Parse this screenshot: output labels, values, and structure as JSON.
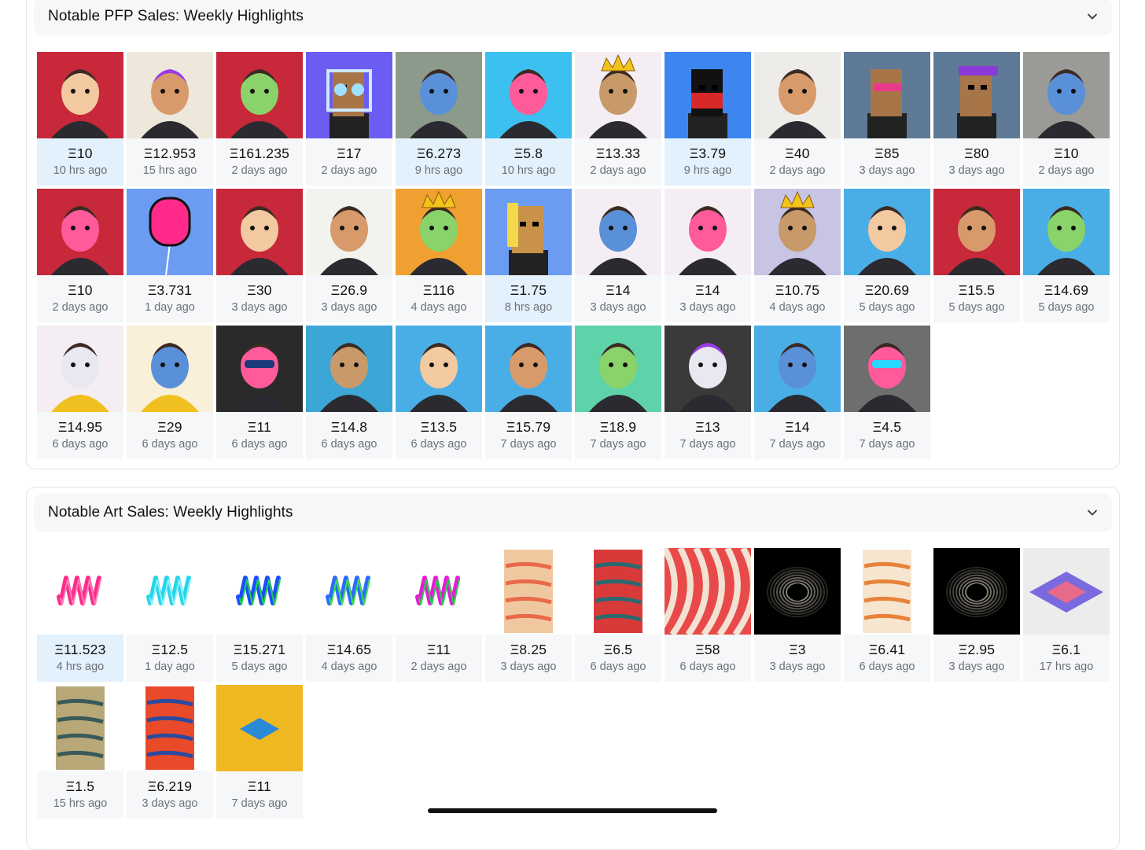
{
  "pfp_section": {
    "title": "Notable PFP Sales: Weekly Highlights",
    "toggle_icon": "chevron-down-icon",
    "items": [
      {
        "price": "Ξ10",
        "time": "10 hrs ago",
        "highlight": true,
        "bg": "#c7283a",
        "avatar": "round-armored-character"
      },
      {
        "price": "Ξ12.953",
        "time": "15 hrs ago",
        "highlight": false,
        "bg": "#ede7dc",
        "avatar": "flaming-skull-priest"
      },
      {
        "price": "Ξ161.235",
        "time": "2 days ago",
        "highlight": false,
        "bg": "#c7283a",
        "avatar": "sketch-woman-profile"
      },
      {
        "price": "Ξ17",
        "time": "2 days ago",
        "highlight": false,
        "bg": "#6b5cf2",
        "avatar": "pixel-owl"
      },
      {
        "price": "Ξ6.273",
        "time": "9 hrs ago",
        "highlight": true,
        "bg": "#8b9a8a",
        "avatar": "green-creature-headphones"
      },
      {
        "price": "Ξ5.8",
        "time": "10 hrs ago",
        "highlight": true,
        "bg": "#3cc0f0",
        "avatar": "hooded-ghost"
      },
      {
        "price": "Ξ13.33",
        "time": "2 days ago",
        "highlight": false,
        "bg": "#f4eef4",
        "avatar": "clown-king"
      },
      {
        "price": "Ξ3.79",
        "time": "9 hrs ago",
        "highlight": true,
        "bg": "#3d86f0",
        "avatar": "pixel-ninja"
      },
      {
        "price": "Ξ40",
        "time": "2 days ago",
        "highlight": false,
        "bg": "#eeece8",
        "avatar": "anime-pilot"
      },
      {
        "price": "Ξ85",
        "time": "3 days ago",
        "highlight": false,
        "bg": "#5e7a96",
        "avatar": "pixel-punk-glasses"
      },
      {
        "price": "Ξ80",
        "time": "3 days ago",
        "highlight": false,
        "bg": "#5e7a96",
        "avatar": "pixel-punk-cap"
      },
      {
        "price": "Ξ10",
        "time": "2 days ago",
        "highlight": false,
        "bg": "#9a9a96",
        "avatar": "blue-warrior-axe"
      },
      {
        "price": "Ξ10",
        "time": "2 days ago",
        "highlight": false,
        "bg": "#c7283a",
        "avatar": "dark-ninja-character"
      },
      {
        "price": "Ξ3.731",
        "time": "1 day ago",
        "highlight": false,
        "bg": "#6b9cf2",
        "avatar": "pink-balloon-head"
      },
      {
        "price": "Ξ30",
        "time": "3 days ago",
        "highlight": false,
        "bg": "#c7283a",
        "avatar": "boy-profile"
      },
      {
        "price": "Ξ26.9",
        "time": "3 days ago",
        "highlight": false,
        "bg": "#f2f2ee",
        "avatar": "anime-twins"
      },
      {
        "price": "Ξ116",
        "time": "4 days ago",
        "highlight": false,
        "bg": "#f0a030",
        "avatar": "crowned-ape"
      },
      {
        "price": "Ξ1.75",
        "time": "8 hrs ago",
        "highlight": true,
        "bg": "#6b9cf2",
        "avatar": "pixel-blonde"
      },
      {
        "price": "Ξ14",
        "time": "3 days ago",
        "highlight": false,
        "bg": "#f4eef4",
        "avatar": "bearded-man-jacket"
      },
      {
        "price": "Ξ14",
        "time": "3 days ago",
        "highlight": false,
        "bg": "#f4eef4",
        "avatar": "bearded-man-pipe"
      },
      {
        "price": "Ξ10.75",
        "time": "4 days ago",
        "highlight": false,
        "bg": "#c8c4e4",
        "avatar": "crowned-penguin"
      },
      {
        "price": "Ξ20.69",
        "time": "5 days ago",
        "highlight": false,
        "bg": "#4aaee6",
        "avatar": "red-baby-creature"
      },
      {
        "price": "Ξ15.5",
        "time": "5 days ago",
        "highlight": false,
        "bg": "#c7283a",
        "avatar": "red-club-character"
      },
      {
        "price": "Ξ14.69",
        "time": "5 days ago",
        "highlight": false,
        "bg": "#4aaee6",
        "avatar": "blue-baby-creature"
      },
      {
        "price": "Ξ14.95",
        "time": "6 days ago",
        "highlight": false,
        "bg": "#f4eef4",
        "avatar": "man-yellow-jacket"
      },
      {
        "price": "Ξ29",
        "time": "6 days ago",
        "highlight": false,
        "bg": "#f8f0d8",
        "avatar": "man-gold-outfit"
      },
      {
        "price": "Ξ11",
        "time": "6 days ago",
        "highlight": false,
        "bg": "#2a2a2a",
        "avatar": "sunglasses-kid"
      },
      {
        "price": "Ξ14.8",
        "time": "6 days ago",
        "highlight": false,
        "bg": "#3ca6d6",
        "avatar": "green-zombie-ape"
      },
      {
        "price": "Ξ13.5",
        "time": "6 days ago",
        "highlight": false,
        "bg": "#4aaee6",
        "avatar": "pink-octopus-baby"
      },
      {
        "price": "Ξ15.79",
        "time": "7 days ago",
        "highlight": false,
        "bg": "#4aaee6",
        "avatar": "pink-octopus-baby-2"
      },
      {
        "price": "Ξ18.9",
        "time": "7 days ago",
        "highlight": false,
        "bg": "#5ed2a8",
        "avatar": "zombie-ape-red"
      },
      {
        "price": "Ξ13",
        "time": "7 days ago",
        "highlight": false,
        "bg": "#3a3a3a",
        "avatar": "purple-hair-alien"
      },
      {
        "price": "Ξ14",
        "time": "7 days ago",
        "highlight": false,
        "bg": "#4aaee6",
        "avatar": "blue-baby-creature-2"
      },
      {
        "price": "Ξ4.5",
        "time": "7 days ago",
        "highlight": false,
        "bg": "#6e6e6e",
        "avatar": "cyber-woman"
      }
    ]
  },
  "art_section": {
    "title": "Notable Art Sales: Weekly Highlights",
    "toggle_icon": "chevron-down-icon",
    "items": [
      {
        "price": "Ξ11.523",
        "time": "4 hrs ago",
        "highlight": true,
        "bg": "#ffffff",
        "art": "pink-squiggle",
        "colors": [
          "#ff2a8a",
          "#ff7fb8"
        ]
      },
      {
        "price": "Ξ12.5",
        "time": "1 day ago",
        "highlight": false,
        "bg": "#ffffff",
        "art": "cyan-squiggle",
        "colors": [
          "#22d6e8",
          "#8fefff"
        ]
      },
      {
        "price": "Ξ15.271",
        "time": "5 days ago",
        "highlight": false,
        "bg": "#ffffff",
        "art": "blue-green-squiggle",
        "colors": [
          "#1a4dff",
          "#22d04a"
        ]
      },
      {
        "price": "Ξ14.65",
        "time": "4 days ago",
        "highlight": false,
        "bg": "#ffffff",
        "art": "rainbow-squiggle",
        "colors": [
          "#2a6bff",
          "#3ee04a"
        ]
      },
      {
        "price": "Ξ11",
        "time": "2 days ago",
        "highlight": false,
        "bg": "#ffffff",
        "art": "magenta-squiggle",
        "colors": [
          "#e81ad8",
          "#22d04a"
        ]
      },
      {
        "price": "Ξ8.25",
        "time": "3 days ago",
        "highlight": false,
        "bg": "#ffffff",
        "art": "striped-strata",
        "colors": [
          "#e86a4a",
          "#f0c8a0"
        ]
      },
      {
        "price": "Ξ6.5",
        "time": "6 days ago",
        "highlight": false,
        "bg": "#ffffff",
        "art": "teal-red-abstract",
        "colors": [
          "#2a6a6e",
          "#d83a3a"
        ]
      },
      {
        "price": "Ξ58",
        "time": "6 days ago",
        "highlight": false,
        "bg": "#e84a4a",
        "art": "red-flow-field",
        "colors": [
          "#e84a4a",
          "#f2e2d2"
        ]
      },
      {
        "price": "Ξ3",
        "time": "3 days ago",
        "highlight": false,
        "bg": "#000000",
        "art": "black-hole",
        "colors": [
          "#000000",
          "#f0e8d8"
        ]
      },
      {
        "price": "Ξ6.41",
        "time": "6 days ago",
        "highlight": false,
        "bg": "#ffffff",
        "art": "orange-marble",
        "colors": [
          "#e8823a",
          "#f6e6d0"
        ]
      },
      {
        "price": "Ξ2.95",
        "time": "3 days ago",
        "highlight": false,
        "bg": "#000000",
        "art": "black-hole-2",
        "colors": [
          "#000000",
          "#f0e8d8"
        ]
      },
      {
        "price": "Ξ6.1",
        "time": "17 hrs ago",
        "highlight": false,
        "bg": "#ececec",
        "art": "isometric-quilt",
        "colors": [
          "#7a6ae0",
          "#e86a8a"
        ]
      },
      {
        "price": "Ξ1.5",
        "time": "15 hrs ago",
        "highlight": false,
        "bg": "#ffffff",
        "art": "camo-terrain",
        "colors": [
          "#3a5a5a",
          "#b8a878"
        ]
      },
      {
        "price": "Ξ6.219",
        "time": "3 days ago",
        "highlight": false,
        "bg": "#ffffff",
        "art": "layered-strata",
        "colors": [
          "#2a4aa0",
          "#e84a2a"
        ]
      },
      {
        "price": "Ξ11",
        "time": "7 days ago",
        "highlight": false,
        "bg": "#f0b820",
        "art": "isometric-grid",
        "colors": [
          "#f0b820",
          "#2a8ad8"
        ]
      }
    ]
  }
}
